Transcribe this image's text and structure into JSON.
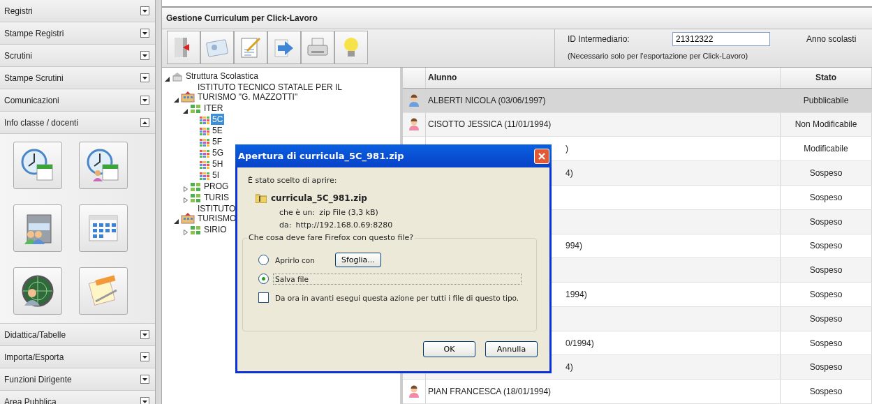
{
  "sidebar": {
    "sections": [
      {
        "label": "Registri",
        "expanded": false
      },
      {
        "label": "Stampe Registri",
        "expanded": false
      },
      {
        "label": "Scrutini",
        "expanded": false
      },
      {
        "label": "Stampe Scrutini",
        "expanded": false
      },
      {
        "label": "Comunicazioni",
        "expanded": false
      },
      {
        "label": "Info classe / docenti",
        "expanded": true,
        "launchers": [
          {
            "kind": "clock-calendar"
          },
          {
            "kind": "clock-people"
          },
          {
            "kind": "cabinet"
          },
          {
            "kind": "calendar"
          },
          {
            "kind": "radar"
          },
          {
            "kind": "notepad"
          }
        ]
      },
      {
        "label": "Didattica/Tabelle",
        "expanded": false
      },
      {
        "label": "Importa/Esporta",
        "expanded": false
      },
      {
        "label": "Funzioni Dirigente",
        "expanded": false
      },
      {
        "label": "Area Pubblica",
        "expanded": false
      }
    ]
  },
  "header": {
    "title": "Gestione Curriculum per Click-Lavoro"
  },
  "toolbar": {
    "buttons": [
      {
        "kind": "exit"
      },
      {
        "kind": "card"
      },
      {
        "kind": "edit"
      },
      {
        "kind": "forward"
      },
      {
        "kind": "print"
      },
      {
        "kind": "tip"
      }
    ],
    "id_label": "ID Intermediario:",
    "id_value": "21312322",
    "id_note": "(Necessario solo per l'esportazione per Click-Lavoro)",
    "year_label": "Anno scolasti"
  },
  "tree": {
    "label": "Struttura Scolastica",
    "kind": "root",
    "expanded": true,
    "selected": false,
    "children": [
      {
        "label": "ISTITUTO TECNICO STATALE PER IL\nTURISMO \"G. MAZZOTTI\"",
        "kind": "school",
        "expanded": true,
        "selected": false,
        "children": [
          {
            "label": "ITER",
            "kind": "course",
            "expanded": true,
            "selected": false,
            "children": [
              {
                "label": "5C",
                "kind": "class",
                "selected": true
              },
              {
                "label": "5E",
                "kind": "class",
                "selected": false
              },
              {
                "label": "5F",
                "kind": "class",
                "selected": false
              },
              {
                "label": "5G",
                "kind": "class",
                "selected": false
              },
              {
                "label": "5H",
                "kind": "class",
                "selected": false
              },
              {
                "label": "5I",
                "kind": "class",
                "selected": false
              }
            ]
          },
          {
            "label": "PROG",
            "kind": "course",
            "expanded": false,
            "selected": false
          },
          {
            "label": "TURIS",
            "kind": "course",
            "expanded": false,
            "selected": false
          }
        ]
      },
      {
        "label": "ISTITUTO\nTURISMO",
        "kind": "school",
        "expanded": true,
        "selected": false,
        "children": [
          {
            "label": "SIRIO",
            "kind": "course",
            "expanded": false,
            "selected": false
          }
        ]
      }
    ]
  },
  "table": {
    "columns": [
      {
        "label": "Alunno"
      },
      {
        "label": "Stato"
      }
    ],
    "rows": [
      {
        "color": "#6aa0e0",
        "name": "ALBERTI NICOLA (03/06/1997)",
        "status": "Pubblicabile",
        "selected": true
      },
      {
        "color": "#f08aa8",
        "name": "CISOTTO JESSICA (11/01/1994)",
        "status": "Non Modificabile",
        "selected": false
      },
      {
        "name_tail": ")",
        "status": "Modificabile",
        "selected": false
      },
      {
        "name_tail": "4)",
        "status": "Sospeso",
        "selected": false
      },
      {
        "status": "Sospeso",
        "selected": false
      },
      {
        "status": "Sospeso",
        "selected": false
      },
      {
        "name_tail": "994)",
        "status": "Sospeso",
        "selected": false
      },
      {
        "status": "Sospeso",
        "selected": false
      },
      {
        "name_tail": "1994)",
        "status": "Sospeso",
        "selected": false
      },
      {
        "status": "Sospeso",
        "selected": false
      },
      {
        "name_tail": "0/1994)",
        "status": "Sospeso",
        "selected": false
      },
      {
        "name_tail": "4)",
        "status": "Sospeso",
        "selected": false
      },
      {
        "color": "#f08aa8",
        "name": "PIAN FRANCESCA (18/01/1994)",
        "status": "Sospeso",
        "selected": false
      }
    ]
  },
  "dialog": {
    "title": "Apertura di curricula_5C_981.zip",
    "intro": "È stato scelto di aprire:",
    "file_name": "curricula_5C_981.zip",
    "type_label": "che è un:",
    "type_value": "zip File (3,3 kB)",
    "from_label": "da:",
    "from_value": "http://192.168.0.69:8280",
    "question": "Che cosa deve fare Firefox con questo file?",
    "options": [
      {
        "label": "Aprirlo con",
        "selected": false,
        "button": "Sfoglia..."
      },
      {
        "label": "Salva file",
        "selected": true
      }
    ],
    "remember": {
      "label": "Da ora in avanti esegui questa azione per tutti i file di questo tipo.",
      "checked": false
    },
    "buttons": [
      "OK",
      "Annulla"
    ]
  }
}
